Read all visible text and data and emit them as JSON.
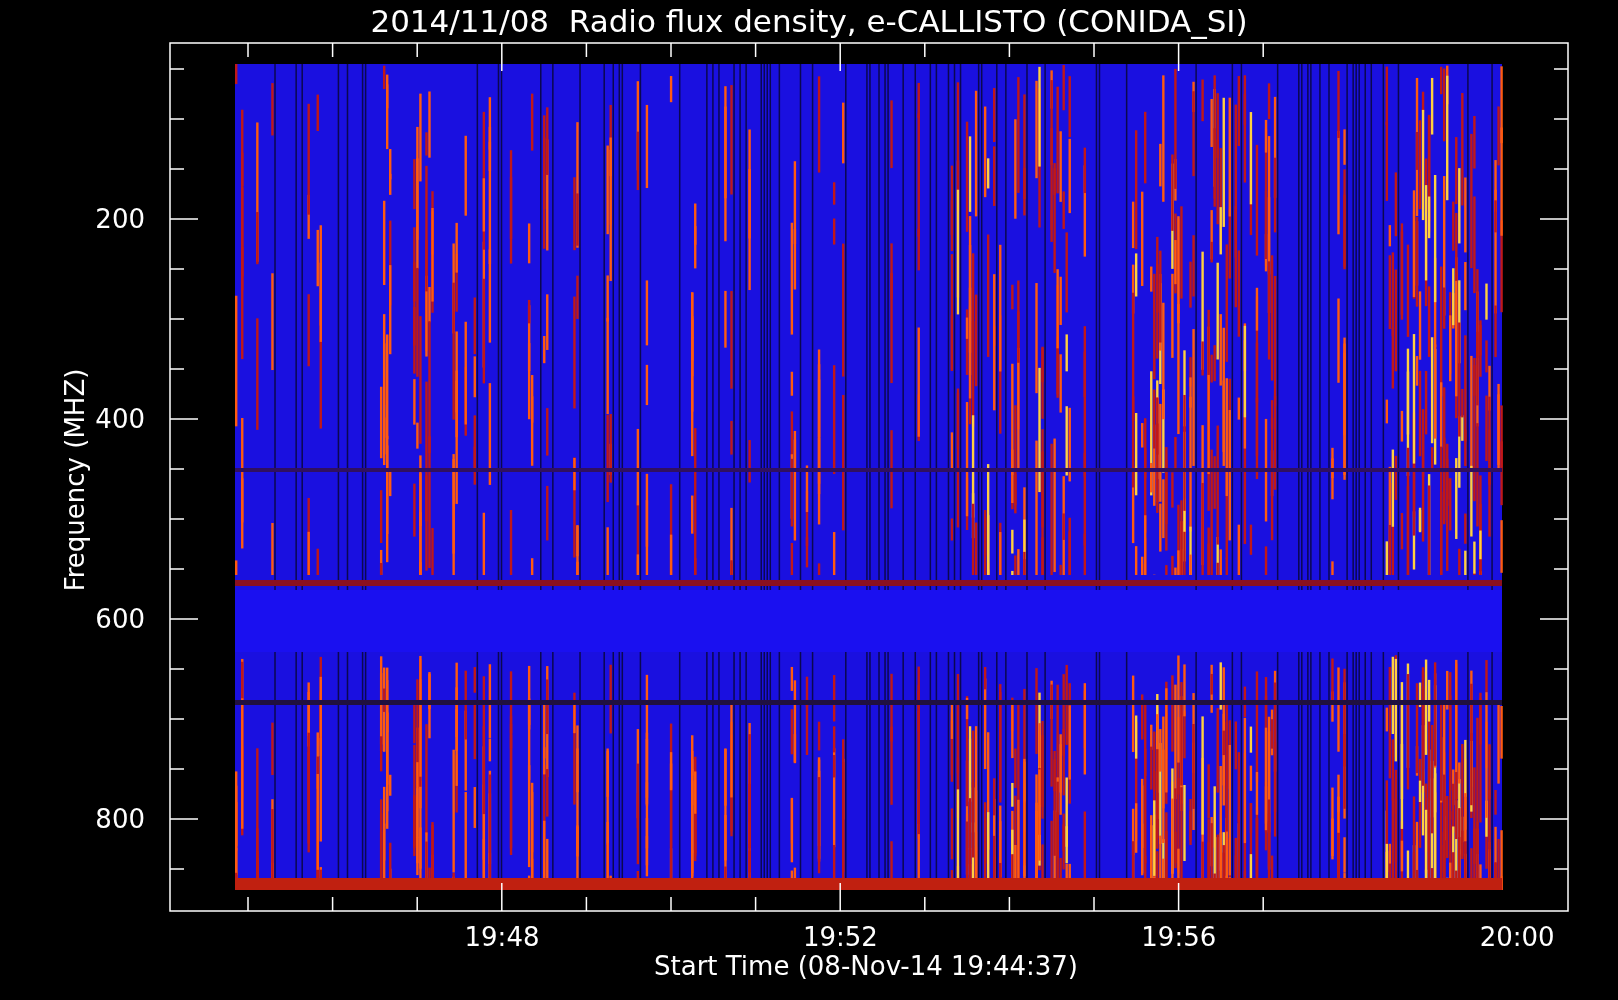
{
  "title": "2014/11/08  Radio flux density, e-CALLISTO (CONIDA_SI)",
  "ylabel": "Frequency (MHZ)",
  "xlabel": "Start Time (08-Nov-14 19:44:37)",
  "yticks": [
    "200",
    "400",
    "600",
    "800"
  ],
  "xticks": [
    "19:48",
    "19:52",
    "19:56",
    "20:00"
  ]
}
